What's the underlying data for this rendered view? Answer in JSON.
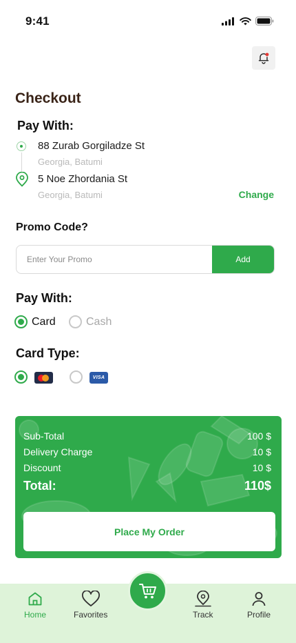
{
  "status_bar": {
    "time": "9:41"
  },
  "header": {
    "title": "Checkout"
  },
  "address": {
    "heading": "Pay With:",
    "from": {
      "street": "88 Zurab Gorgiladze St",
      "city": "Georgia, Batumi"
    },
    "to": {
      "street": "5 Noe Zhordania St",
      "city": "Georgia, Batumi"
    },
    "change_label": "Change"
  },
  "promo": {
    "heading": "Promo Code?",
    "placeholder": "Enter Your Promo",
    "value": "",
    "add_label": "Add"
  },
  "payment": {
    "heading": "Pay With:",
    "options": [
      {
        "label": "Card",
        "selected": true
      },
      {
        "label": "Cash",
        "selected": false
      }
    ]
  },
  "card_type": {
    "heading": "Card Type:",
    "options": [
      {
        "name": "mastercard",
        "selected": true
      },
      {
        "name": "visa",
        "label": "VISA",
        "selected": false
      }
    ]
  },
  "summary": {
    "rows": [
      {
        "label": "Sub-Total",
        "value": "100 $"
      },
      {
        "label": "Delivery Charge",
        "value": "10 $"
      },
      {
        "label": "Discount",
        "value": "10 $"
      }
    ],
    "total": {
      "label": "Total:",
      "value": "110$"
    },
    "order_button": "Place My Order"
  },
  "bottom_nav": {
    "items": [
      {
        "label": "Home",
        "icon": "home-icon",
        "active": true
      },
      {
        "label": "Favorites",
        "icon": "heart-icon",
        "active": false
      },
      {
        "label": "Track",
        "icon": "map-pin-icon",
        "active": false
      },
      {
        "label": "Profile",
        "icon": "user-icon",
        "active": false
      }
    ],
    "center_icon": "cart-icon"
  },
  "colors": {
    "accent": "#2faa4b",
    "nav_background": "#def3d9",
    "title": "#3a2418",
    "muted": "#b9b9b9"
  }
}
